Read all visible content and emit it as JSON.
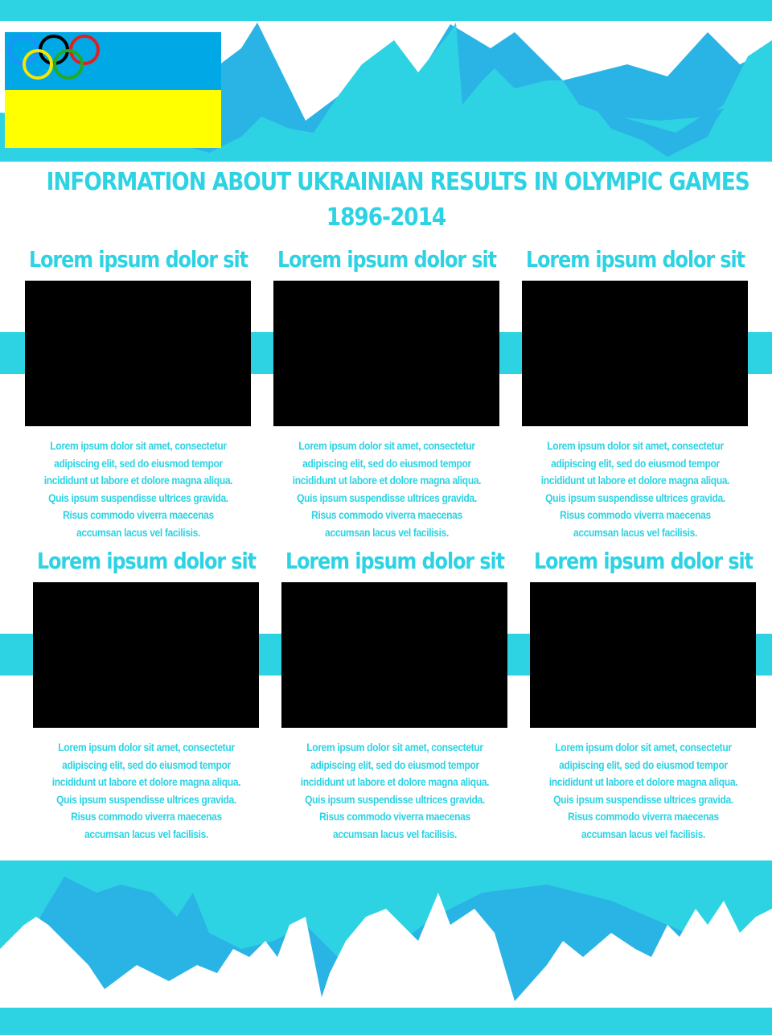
{
  "header": {
    "title_line1": "INFORMATION ABOUT UKRAINIAN RESULTS IN OLYMPIC GAMES",
    "title_line2": "1896-2014"
  },
  "colors": {
    "accent": "#2dd3e3",
    "mountain_dark": "#2ab4e5",
    "flag_blue": "#00a8e6",
    "flag_yellow": "#ffff00",
    "image_placeholder": "#000000"
  },
  "cards": [
    {
      "heading": "Lorem ipsum dolor sit",
      "lines": [
        "Lorem ipsum dolor sit amet, consectetur",
        "adipiscing elit, sed do eiusmod tempor",
        "incididunt ut labore et dolore magna aliqua.",
        "Quis ipsum suspendisse ultrices gravida.",
        "Risus commodo viverra maecenas",
        "accumsan lacus vel facilisis."
      ]
    },
    {
      "heading": "Lorem ipsum dolor sit",
      "lines": [
        "Lorem ipsum dolor sit amet, consectetur",
        "adipiscing elit, sed do eiusmod tempor",
        "incididunt ut labore et dolore magna aliqua.",
        "Quis ipsum suspendisse ultrices gravida.",
        "Risus commodo viverra maecenas",
        "accumsan lacus vel facilisis."
      ]
    },
    {
      "heading": "Lorem ipsum dolor sit",
      "lines": [
        "Lorem ipsum dolor sit amet, consectetur",
        "adipiscing elit, sed do eiusmod tempor",
        "incididunt ut labore et dolore magna aliqua.",
        "Quis ipsum suspendisse ultrices gravida.",
        "Risus commodo viverra maecenas",
        "accumsan lacus vel facilisis."
      ]
    },
    {
      "heading": "Lorem ipsum dolor sit",
      "lines": [
        "Lorem ipsum dolor sit amet, consectetur",
        "adipiscing elit, sed do eiusmod tempor",
        "incididunt ut labore et dolore magna aliqua.",
        "Quis ipsum suspendisse ultrices gravida.",
        "Risus commodo viverra maecenas",
        "accumsan lacus vel facilisis."
      ]
    },
    {
      "heading": "Lorem ipsum dolor sit",
      "lines": [
        "Lorem ipsum dolor sit amet, consectetur",
        "adipiscing elit, sed do eiusmod tempor",
        "incididunt ut labore et dolore magna aliqua.",
        "Quis ipsum suspendisse ultrices gravida.",
        "Risus commodo viverra maecenas",
        "accumsan lacus vel facilisis."
      ]
    },
    {
      "heading": "Lorem ipsum dolor sit",
      "lines": [
        "Lorem ipsum dolor sit amet, consectetur",
        "adipiscing elit, sed do eiusmod tempor",
        "incididunt ut labore et dolore magna aliqua.",
        "Quis ipsum suspendisse ultrices gravida.",
        "Risus commodo viverra maecenas",
        "accumsan lacus vel facilisis."
      ]
    }
  ]
}
